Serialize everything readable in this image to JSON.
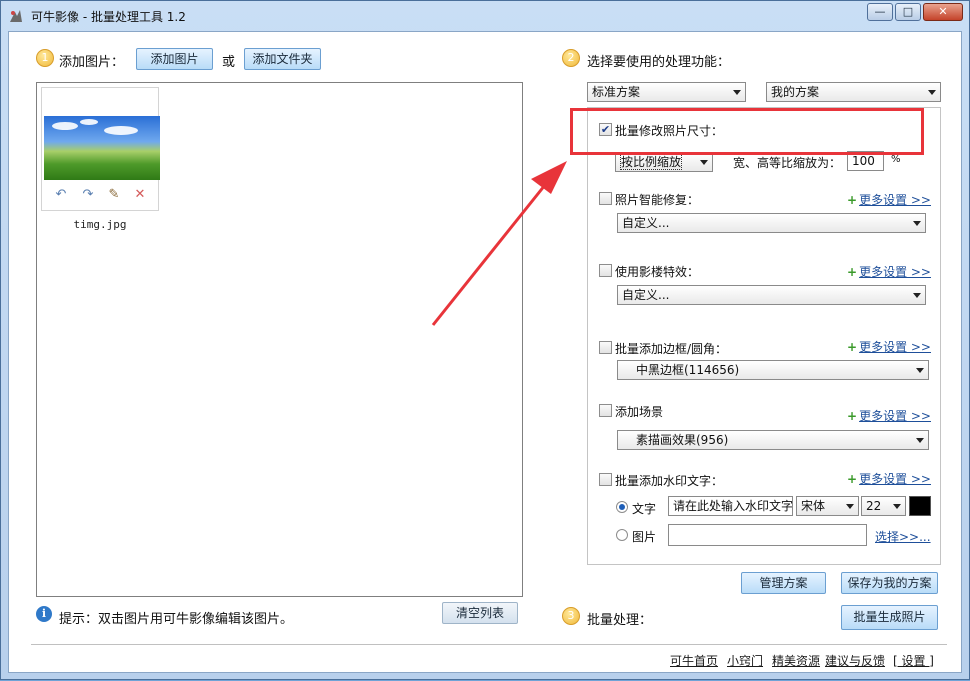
{
  "window": {
    "title": "可牛影像 - 批量处理工具 1.2",
    "min": "—",
    "max": "□",
    "close": "✕"
  },
  "add": {
    "step": "1",
    "label": "添加图片：",
    "add_images": "添加图片",
    "or": "或",
    "add_folder": "添加文件夹"
  },
  "images": [
    {
      "filename": "timg.jpg",
      "tools": [
        "rotate-left-icon",
        "rotate-right-icon",
        "edit-icon",
        "delete-icon"
      ]
    }
  ],
  "tip": {
    "icon": "i",
    "text": "提示：双击图片用可牛影像编辑该图片。",
    "clear_list": "清空列表"
  },
  "functions": {
    "step": "2",
    "label": "选择要使用的处理功能：",
    "preset_select": "标准方案",
    "my_select": "我的方案",
    "resize": {
      "label": "批量修改照片尺寸：",
      "checked": true,
      "mode": "按比例缩放",
      "ratio_label": "宽、高等比缩放为：",
      "value": "100",
      "unit": "%"
    },
    "repair": {
      "label": "照片智能修复：",
      "checked": false,
      "more": "更多设置 >>",
      "select": "自定义..."
    },
    "effect": {
      "label": "使用影楼特效：",
      "checked": false,
      "more": "更多设置 >>",
      "select": "自定义..."
    },
    "border": {
      "label": "批量添加边框/圆角：",
      "checked": false,
      "more": "更多设置 >>",
      "select": "中黑边框(114656)"
    },
    "scene": {
      "label": "添加场景",
      "checked": false,
      "more": "更多设置 >>",
      "select": "素描画效果(956)"
    },
    "watermark": {
      "label": "批量添加水印文字：",
      "checked": false,
      "more": "更多设置 >>",
      "text_radio": "文字",
      "text_value": "请在此处输入水印文字",
      "font": "宋体",
      "size": "22",
      "color": "#000000",
      "image_radio": "图片",
      "image_value": "",
      "browse": "选择>>..."
    }
  },
  "plan_buttons": {
    "manage": "管理方案",
    "save": "保存为我的方案"
  },
  "batch": {
    "step": "3",
    "label": "批量处理：",
    "generate": "批量生成照片"
  },
  "footer": [
    "可牛首页",
    "小窍门",
    "精美资源",
    "建议与反馈",
    "[ 设置 ]"
  ],
  "colors": {
    "highlight_box": "#e8343a",
    "arrow": "#e8343a",
    "button_blue": "#b9dcf8",
    "step_orange": "#f0b93a"
  }
}
